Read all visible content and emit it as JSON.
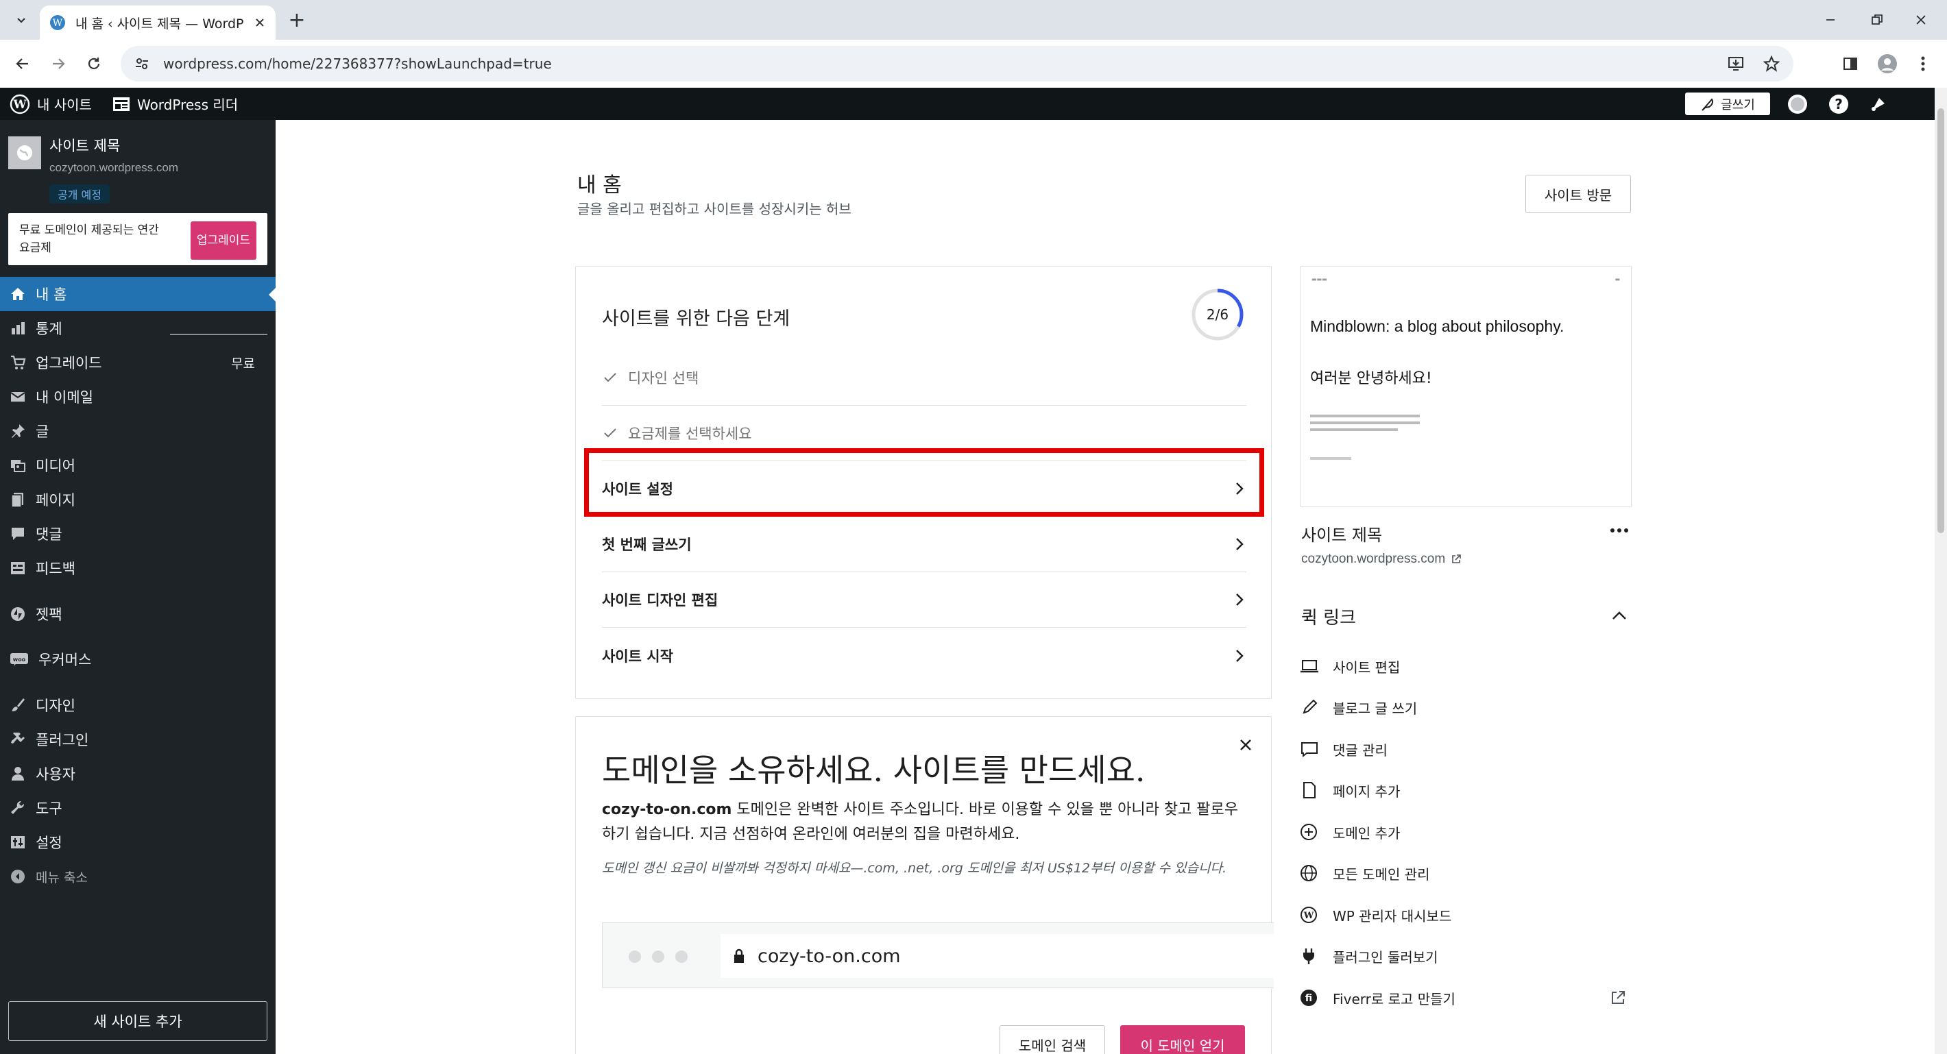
{
  "browser": {
    "tab_title": "내 홈 ‹ 사이트 제목 — WordPress.com",
    "url": "wordpress.com/home/227368377?showLaunchpad=true"
  },
  "adminbar": {
    "my_sites": "내 사이트",
    "reader": "WordPress 리더",
    "write": "글쓰기"
  },
  "sidebar": {
    "site_name": "사이트 제목",
    "site_url": "cozytoon.wordpress.com",
    "site_status": "공개 예정",
    "upsell_text": "무료 도메인이 제공되는 연간 요금제",
    "upsell_button": "업그레이드",
    "items": [
      {
        "label": "내 홈",
        "icon": "home-icon"
      },
      {
        "label": "통계",
        "icon": "stats-icon"
      },
      {
        "label": "업그레이드",
        "icon": "cart-icon",
        "badge": "무료"
      },
      {
        "label": "내 이메일",
        "icon": "mail-icon"
      },
      {
        "label": "글",
        "icon": "pin-icon"
      },
      {
        "label": "미디어",
        "icon": "media-icon"
      },
      {
        "label": "페이지",
        "icon": "page-icon"
      },
      {
        "label": "댓글",
        "icon": "comment-icon"
      },
      {
        "label": "피드백",
        "icon": "feedback-icon"
      },
      {
        "label": "젯팩",
        "icon": "jetpack-icon"
      },
      {
        "label": "우커머스",
        "icon": "woo-icon"
      },
      {
        "label": "디자인",
        "icon": "brush-icon"
      },
      {
        "label": "플러그인",
        "icon": "plugin-icon"
      },
      {
        "label": "사용자",
        "icon": "user-icon"
      },
      {
        "label": "도구",
        "icon": "wrench-icon"
      },
      {
        "label": "설정",
        "icon": "settings-icon"
      },
      {
        "label": "메뉴 축소",
        "icon": "collapse-icon"
      }
    ],
    "add_site": "새 사이트 추가"
  },
  "main": {
    "title": "내 홈",
    "subtitle": "글을 올리고 편집하고 사이트를 성장시키는 허브",
    "visit_site": "사이트 방문",
    "tasks": {
      "title": "사이트를 위한 다음 단계",
      "progress_label": "2/6",
      "progress_fraction": 0.333,
      "items": [
        {
          "label": "디자인 선택",
          "done": true
        },
        {
          "label": "요금제를 선택하세요",
          "done": true
        },
        {
          "label": "사이트 설정",
          "done": false
        },
        {
          "label": "첫 번째 글쓰기",
          "done": false
        },
        {
          "label": "사이트 디자인 편집",
          "done": false
        },
        {
          "label": "사이트 시작",
          "done": false
        }
      ]
    },
    "domain": {
      "headline": "도메인을 소유하세요. 사이트를 만드세요.",
      "domain_name": "cozy-to-on.com",
      "body": "도메인은 완벽한 사이트 주소입니다. 바로 이용할 수 있을 뿐 아니라 찾고 팔로우하기 쉽습니다. 지금 선점하여 온라인에 여러분의 집을 마련하세요.",
      "note": "도메인 갱신 요금이 비쌀까봐 걱정하지 마세요—.com, .net, .org 도메인을 최저 US$12부터 이용할 수 있습니다.",
      "search_button": "도메인 검색",
      "get_button": "이 도메인 얻기"
    }
  },
  "right": {
    "preview_heading": "Mindblown: a blog about philosophy.",
    "preview_hello": "여러분 안녕하세요!",
    "site_name": "사이트 제목",
    "site_url": "cozytoon.wordpress.com",
    "quick_links_title": "퀵 링크",
    "quick_links": [
      {
        "label": "사이트 편집",
        "icon": "laptop-icon"
      },
      {
        "label": "블로그 글 쓰기",
        "icon": "pencil-icon"
      },
      {
        "label": "댓글 관리",
        "icon": "comment-outline-icon"
      },
      {
        "label": "페이지 추가",
        "icon": "page-outline-icon"
      },
      {
        "label": "도메인 추가",
        "icon": "plus-circle-icon"
      },
      {
        "label": "모든 도메인 관리",
        "icon": "globe-icon"
      },
      {
        "label": "WP 관리자 대시보드",
        "icon": "wordpress-icon"
      },
      {
        "label": "플러그인 둘러보기",
        "icon": "plug-icon"
      },
      {
        "label": "Fiverr로 로고 만들기",
        "icon": "fiverr-icon"
      }
    ]
  },
  "colors": {
    "sidebar_bg": "#1d2327",
    "active_blue": "#2271b1",
    "accent_pink": "#d63671",
    "highlight_red": "#e50000"
  }
}
